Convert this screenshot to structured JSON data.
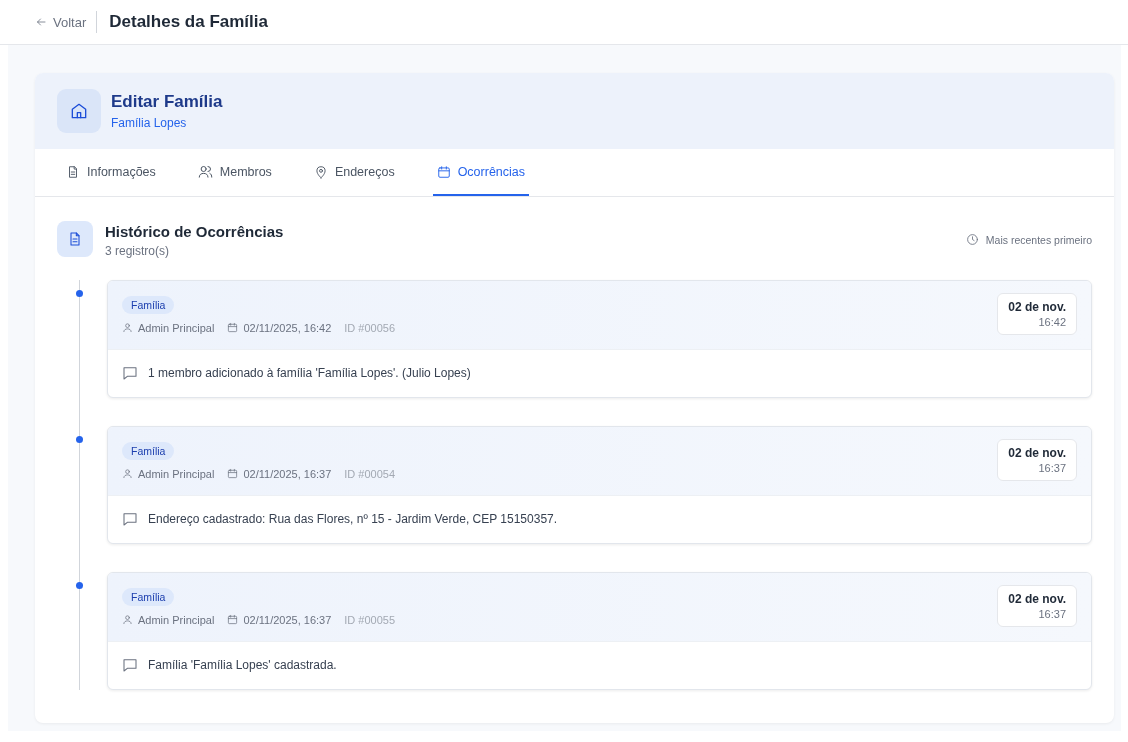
{
  "header": {
    "back_label": "Voltar",
    "title": "Detalhes da Família"
  },
  "family": {
    "title": "Editar Família",
    "subtitle": "Família Lopes"
  },
  "tabs": [
    {
      "label": "Informações",
      "kind": "document",
      "selected": false
    },
    {
      "label": "Membros",
      "kind": "users",
      "selected": false
    },
    {
      "label": "Endereços",
      "kind": "pin",
      "selected": false
    },
    {
      "label": "Ocorrências",
      "kind": "calendar",
      "selected": true
    }
  ],
  "history": {
    "title": "Histórico de Ocorrências",
    "count": "3 registro(s)",
    "sort": "Mais recentes primeiro"
  },
  "occurrences": [
    {
      "tag": "Família",
      "author": "Admin Principal",
      "datetime": "02/11/2025, 16:42",
      "id": "ID #00056",
      "date": "02 de nov.",
      "time": "16:42",
      "message": "1 membro adicionado à família 'Família Lopes'. (Julio Lopes)"
    },
    {
      "tag": "Família",
      "author": "Admin Principal",
      "datetime": "02/11/2025, 16:37",
      "id": "ID #00054",
      "date": "02 de nov.",
      "time": "16:37",
      "message": "Endereço cadastrado: Rua das Flores, nº 15 - Jardim Verde, CEP 15150357."
    },
    {
      "tag": "Família",
      "author": "Admin Principal",
      "datetime": "02/11/2025, 16:37",
      "id": "ID #00055",
      "date": "02 de nov.",
      "time": "16:37",
      "message": "Família 'Família Lopes' cadastrada."
    }
  ]
}
